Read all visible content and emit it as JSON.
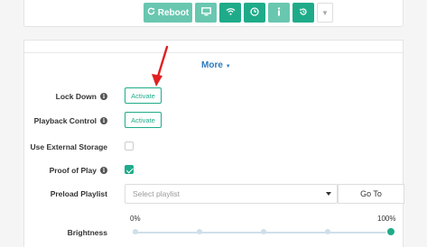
{
  "toolbar": {
    "reboot_label": "Reboot",
    "buttons": [
      {
        "icon": "monitor-icon"
      },
      {
        "icon": "wifi-icon"
      },
      {
        "icon": "clock-icon"
      },
      {
        "icon": "info-icon"
      },
      {
        "icon": "history-icon"
      }
    ]
  },
  "more": {
    "label": "More"
  },
  "rows": {
    "lock_down": {
      "label": "Lock Down",
      "button": "Activate"
    },
    "playback_control": {
      "label": "Playback Control",
      "button": "Activate"
    },
    "external_storage": {
      "label": "Use External Storage",
      "checked": false
    },
    "proof_of_play": {
      "label": "Proof of Play",
      "checked": true
    },
    "preload_playlist": {
      "label": "Preload Playlist",
      "placeholder": "Select playlist",
      "goto": "Go To"
    },
    "brightness": {
      "label": "Brightness",
      "min_label": "0%",
      "max_label": "100%",
      "value_percent": 100
    }
  },
  "colors": {
    "accent": "#1fab89",
    "accent_light": "#69c7b0",
    "link": "#2c7bbd",
    "annotation_arrow": "#e02020"
  }
}
